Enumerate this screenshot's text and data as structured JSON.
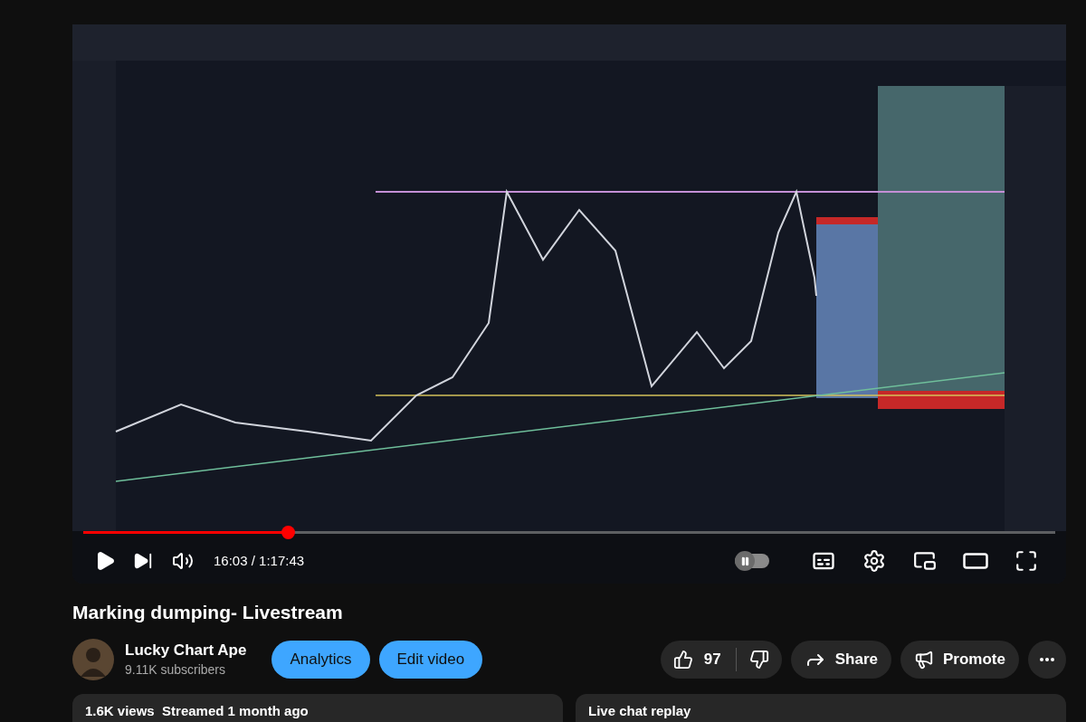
{
  "player": {
    "progress": {
      "level": 0.21
    },
    "time": "16:03 / 1:17:43",
    "autoplay": {
      "on": false
    }
  },
  "title": "Marking dumping- Livestream",
  "channel": {
    "name": "Lucky Chart Ape",
    "subscribers": "9.11K subscribers"
  },
  "buttons": [
    "Analytics",
    "Edit video"
  ],
  "actions": {
    "likes": "97",
    "share": "Share",
    "promote": "Promote"
  },
  "cards": [
    {
      "text": "1.6K views  Streamed 1 month ago"
    },
    {
      "text": "Live chat replay"
    }
  ]
}
